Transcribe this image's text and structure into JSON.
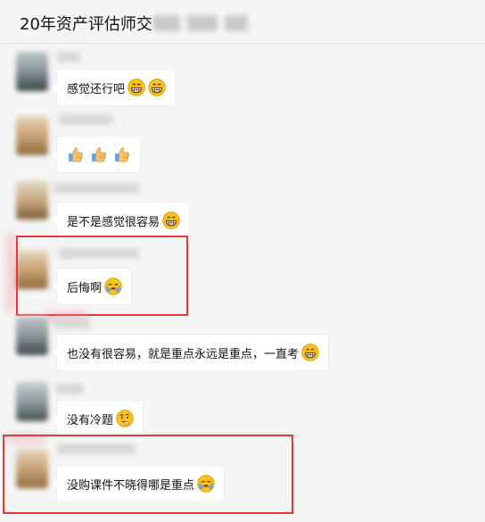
{
  "header": {
    "title": "20年资产评估师交"
  },
  "messages": [
    {
      "text": "感觉还行吧",
      "emojis": [
        "grin-emoji",
        "grin-emoji"
      ]
    },
    {
      "text": "",
      "emojis": [
        "thumbs-up-emoji",
        "thumbs-up-emoji",
        "thumbs-up-emoji"
      ]
    },
    {
      "text": "是不是感觉很容易",
      "emojis": [
        "grin-emoji"
      ]
    },
    {
      "text": "后悔啊",
      "emojis": [
        "crying-emoji"
      ]
    },
    {
      "text": "也没有很容易，就是重点永远是重点，一直考",
      "emojis": [
        "grin-emoji"
      ]
    },
    {
      "text": "没有冷题",
      "emojis": [
        "thinking-emoji"
      ]
    },
    {
      "text": "没购课件不晓得哪是重点",
      "emojis": [
        "crying-emoji"
      ]
    }
  ],
  "colors": {
    "highlight": "#e53935",
    "background": "#f5f5f5",
    "bubble": "#ffffff"
  }
}
